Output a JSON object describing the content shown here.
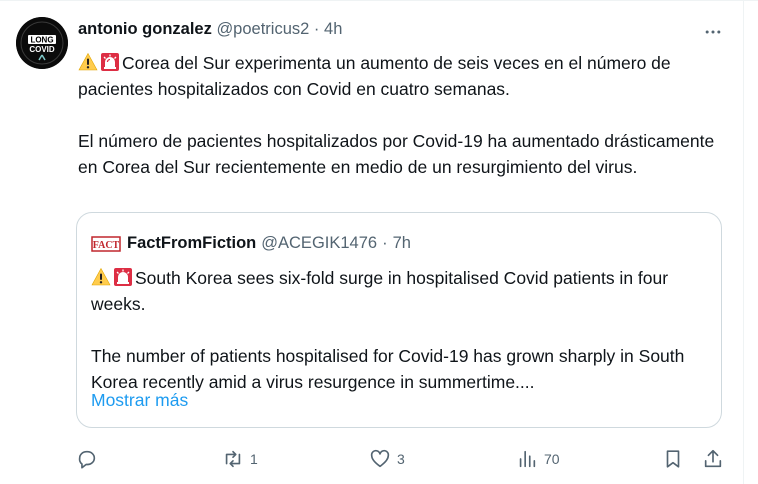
{
  "tweet": {
    "author_name": "antonio gonzalez",
    "author_handle": "@poetricus2",
    "separator": "·",
    "time": "4h",
    "avatar_text": [
      "LONG",
      "COVID"
    ],
    "paragraphs": [
      "Corea del Sur experimenta un aumento de seis veces en el número de pacientes hospitalizados con Covid en cuatro semanas.",
      "El número de pacientes hospitalizados por Covid-19 ha aumentado drásticamente en Corea del Sur recientemente en medio de un resurgimiento del virus."
    ],
    "leading_icons": [
      "warning-emoji",
      "siren-emoji"
    ]
  },
  "quote": {
    "author_name": "FactFromFiction",
    "author_handle": "@ACEGIK1476",
    "separator": "·",
    "time": "7h",
    "avatar_text": "FACT",
    "paragraphs": [
      "South Korea sees six-fold surge in hospitalised Covid patients in four weeks.",
      "The number of patients hospitalised for Covid-19 has grown sharply in South Korea recently amid a virus resurgence in summertime...."
    ],
    "show_more": "Mostrar más"
  },
  "actions": {
    "reply_count": "",
    "retweet_count": "1",
    "like_count": "3",
    "views_count": "70"
  },
  "colors": {
    "text": "#0f1419",
    "secondary": "#536471",
    "link": "#1d9bf0",
    "border": "#cfd9de"
  }
}
